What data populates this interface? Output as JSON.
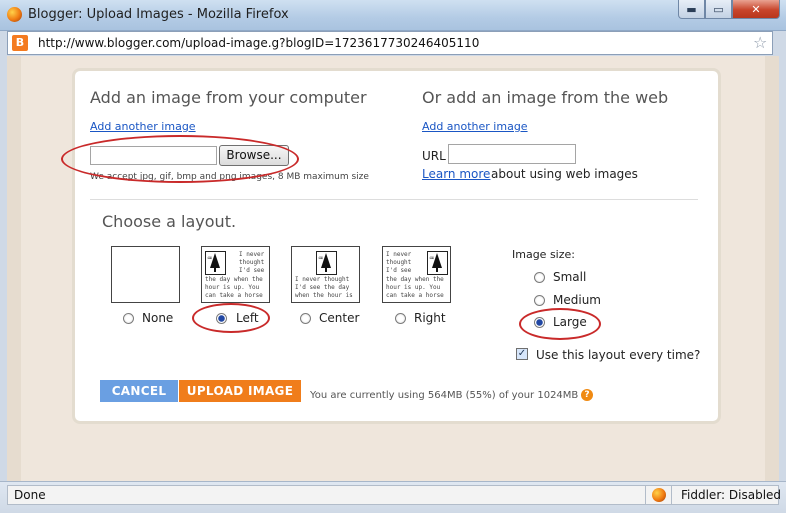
{
  "window": {
    "title": "Blogger: Upload Images - Mozilla Firefox",
    "controls": {
      "minimize": "▬",
      "maximize": "▭",
      "close": "✕"
    }
  },
  "address_bar": {
    "url": "http://www.blogger.com/upload-image.g?blogID=1723617730246405110",
    "favicon": "B"
  },
  "upload": {
    "computer": {
      "heading": "Add an image from your computer",
      "add_another": "Add another image",
      "browse_label": "Browse...",
      "hint": "We accept jpg, gif, bmp and png images, 8 MB maximum size"
    },
    "web": {
      "heading": "Or add an image from the web",
      "add_another": "Add another image",
      "url_label": "URL",
      "learn_more": "Learn more",
      "learn_more_suffix": "about using web images"
    }
  },
  "layout": {
    "heading": "Choose a layout.",
    "options": [
      {
        "label": "None",
        "selected": false
      },
      {
        "label": "Left",
        "selected": true
      },
      {
        "label": "Center",
        "selected": false
      },
      {
        "label": "Right",
        "selected": false
      }
    ],
    "sample_text": {
      "left": [
        "I never",
        "thought",
        "I'd see",
        "the day when the",
        "hour is up. You",
        "can take a horse"
      ],
      "center": [
        "I never thought",
        "I'd see the day",
        "when the hour is"
      ],
      "right": [
        "I never",
        "thought",
        "I'd see",
        "the day when the",
        "hour is up. You",
        "can take a horse"
      ]
    }
  },
  "image_size": {
    "heading": "Image size:",
    "options": [
      {
        "label": "Small",
        "selected": false
      },
      {
        "label": "Medium",
        "selected": false
      },
      {
        "label": "Large",
        "selected": true
      }
    ]
  },
  "remember_layout": {
    "label": "Use this layout every time?",
    "checked": true
  },
  "actions": {
    "cancel": "CANCEL",
    "upload": "UPLOAD IMAGE",
    "usage": "You are currently using 564MB (55%) of your 1024MB –",
    "help": "?"
  },
  "status_bar": {
    "left": "Done",
    "right": "Fiddler: Disabled"
  },
  "colors": {
    "link": "#1a56c4",
    "cancel_button": "#6a9fe2",
    "upload_button": "#f07d1b",
    "annotation": "#c92a2a"
  }
}
